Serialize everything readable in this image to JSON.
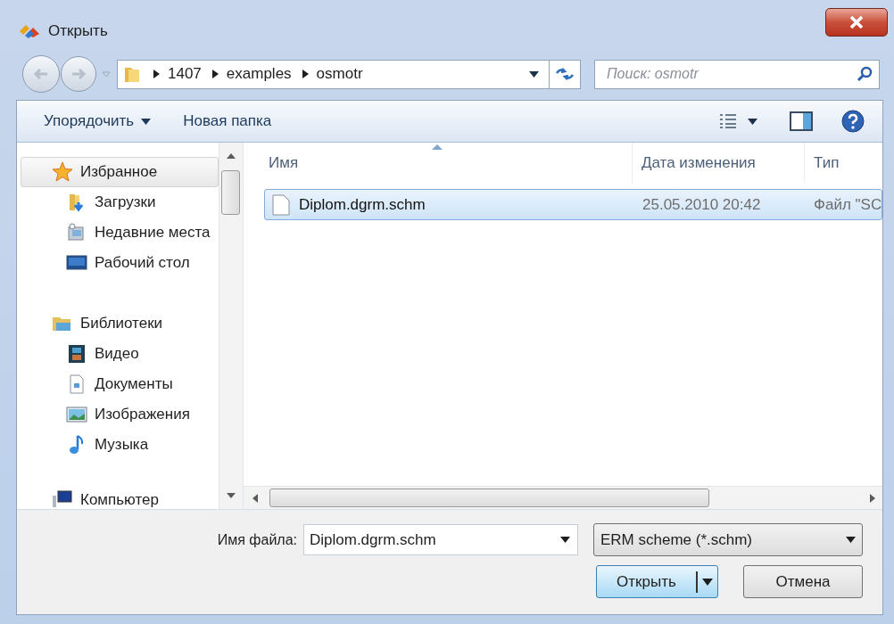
{
  "window": {
    "title": "Открыть"
  },
  "address": {
    "segments": [
      "1407",
      "examples",
      "osmotr"
    ]
  },
  "search": {
    "placeholder": "Поиск: osmotr"
  },
  "toolbar": {
    "organize": "Упорядочить",
    "new_folder": "Новая папка"
  },
  "nav": [
    {
      "kind": "favorites",
      "label": "Избранное",
      "selected": true,
      "children": [
        {
          "kind": "downloads",
          "label": "Загрузки",
          "selected": false
        },
        {
          "kind": "recent",
          "label": "Недавние места",
          "selected": false
        },
        {
          "kind": "desktop",
          "label": "Рабочий стол",
          "selected": false
        }
      ]
    },
    {
      "kind": "libraries",
      "label": "Библиотеки",
      "selected": false,
      "children": [
        {
          "kind": "video",
          "label": "Видео",
          "selected": false
        },
        {
          "kind": "documents",
          "label": "Документы",
          "selected": false
        },
        {
          "kind": "pictures",
          "label": "Изображения",
          "selected": false
        },
        {
          "kind": "music",
          "label": "Музыка",
          "selected": false
        }
      ]
    },
    {
      "kind": "computer",
      "label": "Компьютер",
      "selected": false
    }
  ],
  "columns": [
    {
      "label": "Имя",
      "sorted": true
    },
    {
      "label": "Дата изменения",
      "sorted": false
    },
    {
      "label": "Тип",
      "sorted": false
    }
  ],
  "files": [
    {
      "name": "Diplom.dgrm.schm",
      "date": "25.05.2010 20:42",
      "type": "Файл \"SC",
      "selected": true
    }
  ],
  "file_name": {
    "label": "Имя файла:",
    "value": "Diplom.dgrm.schm"
  },
  "file_type": {
    "value": "ERM scheme (*.schm)"
  },
  "buttons": {
    "open": "Открыть",
    "cancel": "Отмена"
  }
}
